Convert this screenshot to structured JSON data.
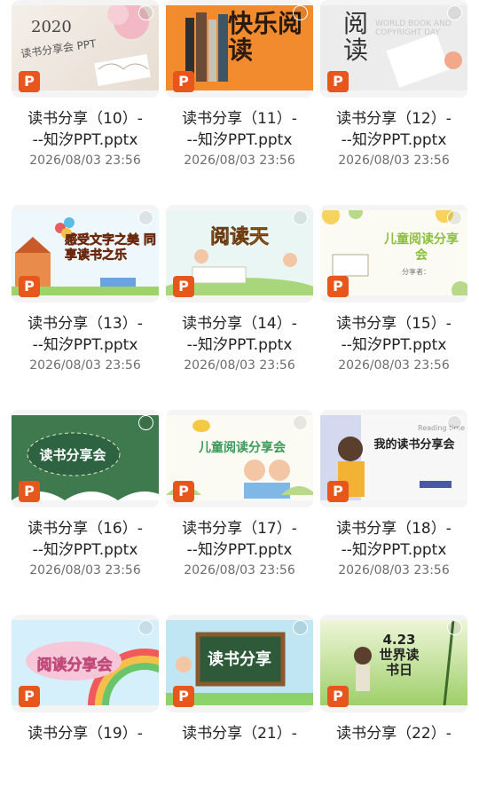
{
  "files": [
    {
      "name_line1": "读书分享（10）-",
      "name_line2": "--知汐PPT.pptx",
      "date": "2026/08/03 23:56",
      "thumb_text": "2020",
      "thumb_sub": "读书分享会 PPT",
      "theme": "pink-book",
      "badge": "P"
    },
    {
      "name_line1": "读书分享（11）-",
      "name_line2": "--知汐PPT.pptx",
      "date": "2026/08/03 23:56",
      "thumb_text": "快乐阅读",
      "thumb_sub": "",
      "theme": "orange-books",
      "badge": "P"
    },
    {
      "name_line1": "读书分享（12）-",
      "name_line2": "--知汐PPT.pptx",
      "date": "2026/08/03 23:56",
      "thumb_text": "阅读",
      "thumb_sub": "WORLD BOOK AND COPYRIGHT DAY",
      "theme": "grey-read",
      "badge": "P"
    },
    {
      "name_line1": "读书分享（13）-",
      "name_line2": "--知汐PPT.pptx",
      "date": "2026/08/03 23:56",
      "thumb_text": "感受文字之美 同享读书之乐",
      "thumb_sub": "",
      "theme": "city-balloons",
      "badge": "P"
    },
    {
      "name_line1": "读书分享（14）-",
      "name_line2": "--知汐PPT.pptx",
      "date": "2026/08/03 23:56",
      "thumb_text": "阅读天",
      "thumb_sub": "",
      "theme": "kids-read",
      "badge": "P"
    },
    {
      "name_line1": "读书分享（15）-",
      "name_line2": "--知汐PPT.pptx",
      "date": "2026/08/03 23:56",
      "thumb_text": "儿童阅读分享会",
      "thumb_sub": "分享者：",
      "theme": "flowers",
      "badge": "P"
    },
    {
      "name_line1": "读书分享（16）-",
      "name_line2": "--知汐PPT.pptx",
      "date": "2026/08/03 23:56",
      "thumb_text": "读书分享会",
      "thumb_sub": "",
      "theme": "green-board",
      "badge": "P"
    },
    {
      "name_line1": "读书分享（17）-",
      "name_line2": "--知汐PPT.pptx",
      "date": "2026/08/03 23:56",
      "thumb_text": "儿童阅读分享会",
      "thumb_sub": "",
      "theme": "kids-bee",
      "badge": "P"
    },
    {
      "name_line1": "读书分享（18）-",
      "name_line2": "--知汐PPT.pptx",
      "date": "2026/08/03 23:56",
      "thumb_text": "我的读书分享会",
      "thumb_sub": "Reading time",
      "theme": "father-child",
      "badge": "P"
    },
    {
      "name_line1": "读书分享（19）-",
      "name_line2": "",
      "date": "",
      "thumb_text": "阅读分享会",
      "thumb_sub": "",
      "theme": "rainbow",
      "badge": "P"
    },
    {
      "name_line1": "读书分享（21）-",
      "name_line2": "",
      "date": "",
      "thumb_text": "读书分享",
      "thumb_sub": "",
      "theme": "chalk",
      "badge": "P"
    },
    {
      "name_line1": "读书分享（22）-",
      "name_line2": "",
      "date": "",
      "thumb_text": "4.23世界读书日",
      "thumb_sub": "",
      "theme": "green-girl",
      "badge": "P"
    }
  ]
}
